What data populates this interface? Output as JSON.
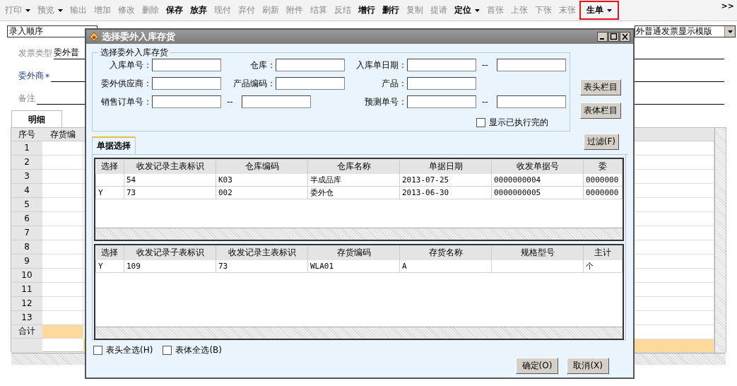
{
  "toolbar": {
    "buttons": [
      {
        "label": "打印",
        "disabled": true,
        "dropdown": true,
        "highlighted": false
      },
      {
        "label": "预览",
        "disabled": true,
        "dropdown": true,
        "highlighted": false
      },
      {
        "label": "输出",
        "disabled": true,
        "dropdown": false,
        "highlighted": false
      },
      {
        "label": "增加",
        "disabled": true,
        "dropdown": false,
        "highlighted": false
      },
      {
        "label": "修改",
        "disabled": true,
        "dropdown": false,
        "highlighted": false
      },
      {
        "label": "删除",
        "disabled": true,
        "dropdown": false,
        "highlighted": false
      },
      {
        "label": "保存",
        "disabled": false,
        "dropdown": false,
        "highlighted": false
      },
      {
        "label": "放弃",
        "disabled": false,
        "dropdown": false,
        "highlighted": false
      },
      {
        "label": "现付",
        "disabled": true,
        "dropdown": false,
        "highlighted": false
      },
      {
        "label": "弃付",
        "disabled": true,
        "dropdown": false,
        "highlighted": false
      },
      {
        "label": "刷新",
        "disabled": true,
        "dropdown": false,
        "highlighted": false
      },
      {
        "label": "附件",
        "disabled": true,
        "dropdown": false,
        "highlighted": false
      },
      {
        "label": "结算",
        "disabled": true,
        "dropdown": false,
        "highlighted": false
      },
      {
        "label": "反结",
        "disabled": true,
        "dropdown": false,
        "highlighted": false
      },
      {
        "label": "增行",
        "disabled": false,
        "dropdown": false,
        "highlighted": false
      },
      {
        "label": "删行",
        "disabled": false,
        "dropdown": false,
        "highlighted": false
      },
      {
        "label": "复制",
        "disabled": true,
        "dropdown": false,
        "highlighted": false
      },
      {
        "label": "提请",
        "disabled": true,
        "dropdown": false,
        "highlighted": false
      },
      {
        "label": "定位",
        "disabled": false,
        "dropdown": true,
        "highlighted": false
      },
      {
        "label": "首张",
        "disabled": true,
        "dropdown": false,
        "highlighted": false
      },
      {
        "label": "上张",
        "disabled": true,
        "dropdown": false,
        "highlighted": false
      },
      {
        "label": "下张",
        "disabled": true,
        "dropdown": false,
        "highlighted": false
      },
      {
        "label": "末张",
        "disabled": true,
        "dropdown": false,
        "highlighted": false
      },
      {
        "label": "生单",
        "disabled": false,
        "dropdown": true,
        "highlighted": true
      }
    ],
    "overflow": ">>"
  },
  "template_select": {
    "value": "录入顺序"
  },
  "display_template_select": {
    "value": "外普通发票显示模版"
  },
  "header_fields": [
    {
      "label": "发票类型",
      "required": false,
      "value": "委外普"
    },
    {
      "label": "委外商",
      "required": true,
      "mark": "*"
    },
    {
      "label": "备注",
      "required": false
    }
  ],
  "detail_tabs": [
    {
      "label": "明细",
      "selected": true
    }
  ],
  "detail_grid": {
    "columns": [
      "序号",
      "存货编"
    ],
    "rows": [
      "1",
      "2",
      "3",
      "4",
      "5",
      "6",
      "7",
      "8",
      "9",
      "10",
      "11",
      "12",
      "13"
    ],
    "total_label": "合计"
  },
  "dialog": {
    "title": "选择委外入库存货",
    "group_title": "选择委外入库存货",
    "filter_rows": [
      [
        {
          "label": "入库单号："
        },
        {
          "label": "仓库："
        },
        {
          "label": "入库单日期：",
          "separator": "--"
        }
      ],
      [
        {
          "label": "委外供应商："
        },
        {
          "label": "产品编码："
        },
        {
          "label": "产品："
        }
      ],
      [
        {
          "label": "销售订单号：",
          "separator": "--"
        },
        {
          "label": "预测单号：",
          "separator": "--"
        }
      ]
    ],
    "side_buttons": [
      "表头栏目",
      "表体栏目"
    ],
    "show_finished": {
      "label": "显示已执行完的",
      "checked": false
    },
    "tabs": [
      {
        "label": "单据选择",
        "selected": true
      }
    ],
    "filter_button": "过滤(F)",
    "header_table": {
      "columns": [
        "选择",
        "收发记录主表标识",
        "仓库编码",
        "仓库名称",
        "单据日期",
        "收发单据号",
        "委"
      ],
      "rows": [
        [
          "",
          "54",
          "K03",
          "半成品库",
          "2013-07-25",
          "0000000004",
          "0000000"
        ],
        [
          "Y",
          "73",
          "002",
          "委外仓",
          "2013-06-30",
          "0000000005",
          "0000000"
        ]
      ]
    },
    "body_table": {
      "columns": [
        "选择",
        "收发记录子表标识",
        "收发记录主表标识",
        "存货编码",
        "存货名称",
        "规格型号",
        "主计"
      ],
      "rows": [
        [
          "Y",
          "109",
          "73",
          "WLA01",
          "A",
          "",
          "个"
        ]
      ]
    },
    "select_all": [
      {
        "label": "表头全选(H)",
        "checked": false
      },
      {
        "label": "表体全选(B)",
        "checked": false
      }
    ],
    "actions": [
      "确定(O)",
      "取消(X)"
    ]
  }
}
